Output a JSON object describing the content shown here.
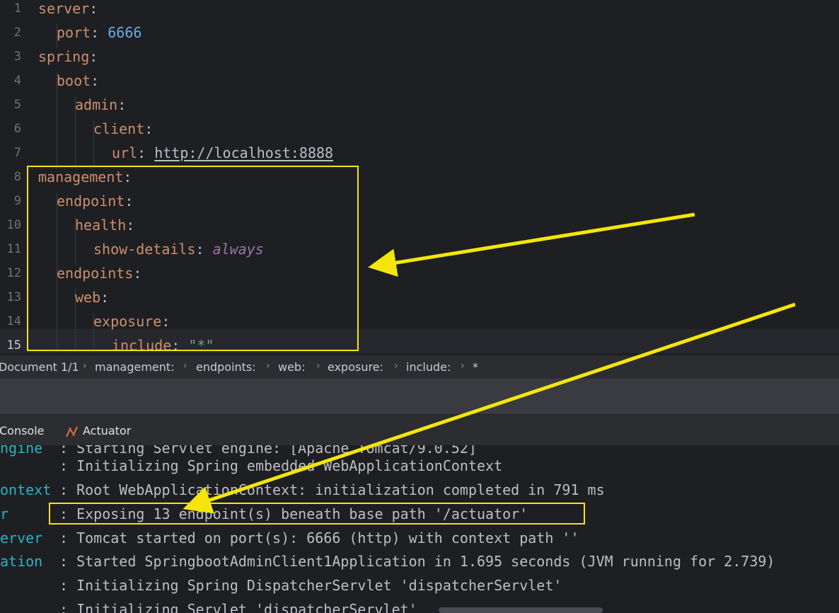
{
  "editor": {
    "line_numbers": [
      "1",
      "2",
      "3",
      "4",
      "5",
      "6",
      "7",
      "8",
      "9",
      "10",
      "11",
      "12",
      "13",
      "14",
      "15"
    ],
    "lines": [
      {
        "key": "server",
        "colon": ":"
      },
      {
        "key": "port",
        "colon": ": ",
        "value": "6666"
      },
      {
        "key": "spring",
        "colon": ":"
      },
      {
        "key": "boot",
        "colon": ":"
      },
      {
        "key": "admin",
        "colon": ":"
      },
      {
        "key": "client",
        "colon": ":"
      },
      {
        "key": "url",
        "colon": ": ",
        "value": "http://localhost:8888"
      },
      {
        "key": "management",
        "colon": ":"
      },
      {
        "key": "endpoint",
        "colon": ":"
      },
      {
        "key": "health",
        "colon": ":"
      },
      {
        "key": "show-details",
        "colon": ": ",
        "value": "always"
      },
      {
        "key": "endpoints",
        "colon": ":"
      },
      {
        "key": "web",
        "colon": ":"
      },
      {
        "key": "exposure",
        "colon": ":"
      },
      {
        "key": "include",
        "colon": ": ",
        "value": "\"*\""
      }
    ]
  },
  "breadcrumb": {
    "items": [
      "Document 1/1",
      "management:",
      "endpoints:",
      "web:",
      "exposure:",
      "include:",
      "*"
    ]
  },
  "tabs": {
    "console_label": "Console",
    "actuator_label": "Actuator"
  },
  "console": {
    "lines": [
      {
        "src": "ngine",
        "msg": ": Starting Servlet engine: [Apache Tomcat/9.0.52]"
      },
      {
        "src": "",
        "msg": ": Initializing Spring embedded WebApplicationContext"
      },
      {
        "src": "ontext",
        "msg": ": Root WebApplicationContext: initialization completed in 791 ms"
      },
      {
        "src": "r",
        "msg": ": Exposing 13 endpoint(s) beneath base path '/actuator'"
      },
      {
        "src": "erver",
        "msg": ": Tomcat started on port(s): 6666 (http) with context path ''"
      },
      {
        "src": "ation",
        "msg": ": Started SpringbootAdminClient1Application in 1.695 seconds (JVM running for 2.739)"
      },
      {
        "src": "",
        "msg": ": Initializing Spring DispatcherServlet 'dispatcherServlet'"
      },
      {
        "src": "",
        "msg": ": Initializing Servlet 'dispatcherServlet'"
      }
    ]
  },
  "colors": {
    "background": "#1e1f22",
    "key": "#cf8e6d",
    "number": "#6aa8e8",
    "italic_value": "#9876aa",
    "string": "#6aab73",
    "console_source": "#2bb3c8",
    "annotation": "#f5e50a"
  },
  "icons": [
    "actuator-icon"
  ]
}
